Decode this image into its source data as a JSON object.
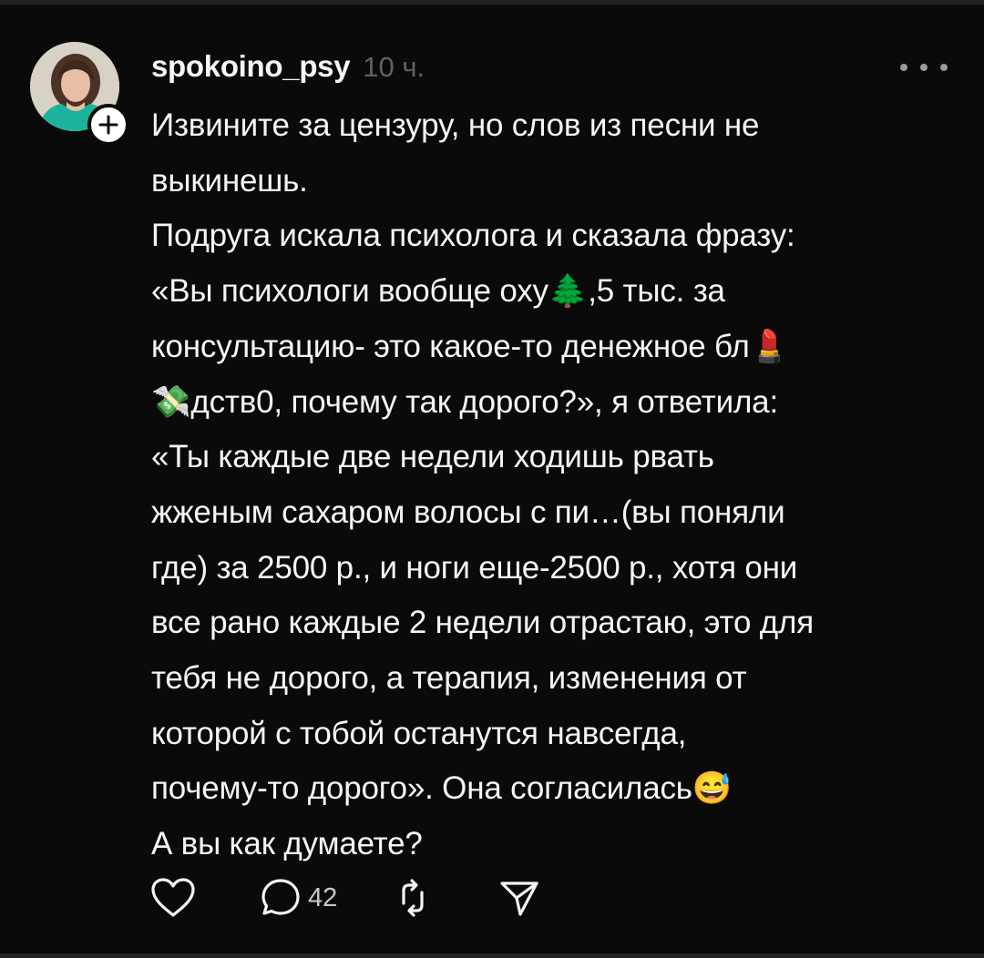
{
  "post": {
    "author": {
      "username": "spokoino_psy",
      "avatar_alt": "avatar"
    },
    "timestamp": "10 ч.",
    "text": "Извините за цензуру, но слов из песни не\nвыкинешь.\nПодруга искала психолога и сказала фразу:\n«Вы психологи вообще оху🌲,5 тыс. за\nконсультацию- это какое-то денежное бл💄\n💸дств0, почему так дорого?», я ответила:\n«Ты каждые две недели ходишь рвать\nжженым сахаром волосы с пи…(вы поняли\nгде) за 2500 р., и ноги еще-2500 р., хотя они\nвсе рано каждые 2 недели отрастаю, это для\nтебя не дорого, а терапия, изменения от\nкоторой с тобой останутся навсегда,\nпочему-то дорого». Она согласилась😅\nА вы как думаете?",
    "actions": {
      "like_icon": "heart-icon",
      "reply_icon": "comment-icon",
      "reply_count": "42",
      "repost_icon": "repost-icon",
      "share_icon": "send-icon"
    }
  },
  "colors": {
    "background": "#0a0a0a",
    "text": "#f3f5f7",
    "secondary_text": "#616161",
    "icon": "#f3f5f7"
  }
}
